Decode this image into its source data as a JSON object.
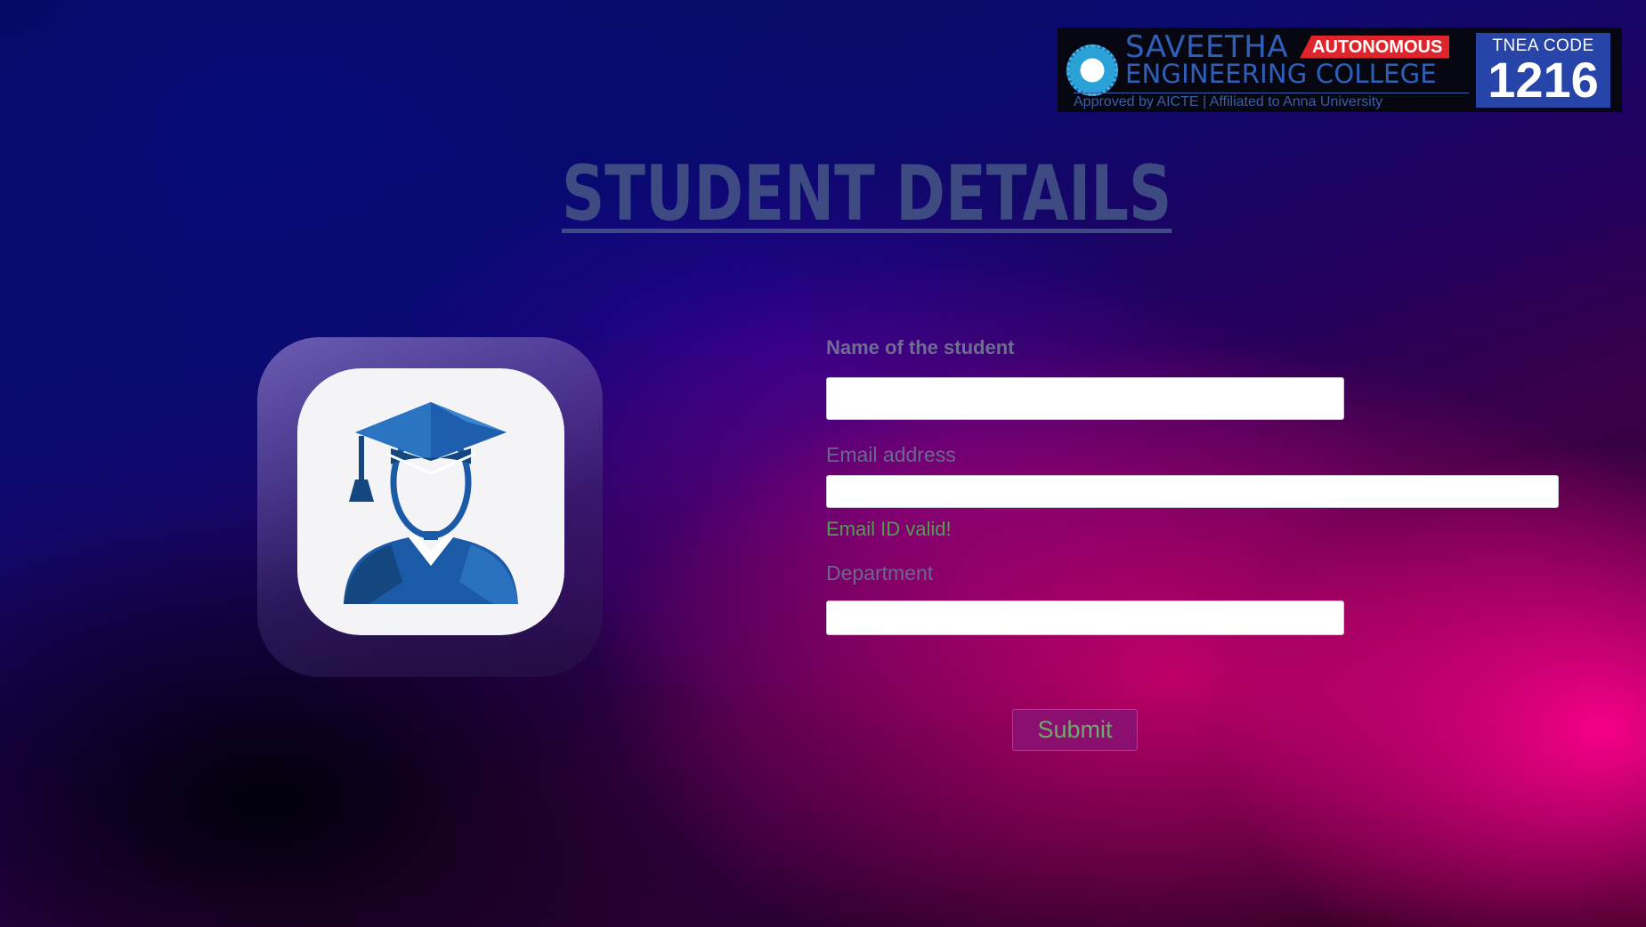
{
  "logo": {
    "college_line1": "SAVEETHA",
    "college_line2": "ENGINEERING COLLEGE",
    "badge": "AUTONOMOUS",
    "approval": "Approved by AICTE  |  Affiliated to Anna University",
    "tnea_label": "TNEA CODE",
    "tnea_code": "1216"
  },
  "page": {
    "title": "STUDENT DETAILS"
  },
  "form": {
    "name_label": "Name of the student",
    "name_value": "",
    "email_label": "Email address",
    "email_value": "",
    "email_status": "Email ID valid!",
    "department_label": "Department",
    "department_value": "",
    "submit_label": "Submit"
  },
  "colors": {
    "title": "#3e4a82",
    "valid": "#4f9f4f",
    "submit_bg": "#8a0f6e",
    "accent_pink": "#ff008c",
    "accent_blue": "#0b0a6e"
  },
  "icons": {
    "avatar": "graduate-student-icon",
    "seal": "college-seal-icon"
  }
}
